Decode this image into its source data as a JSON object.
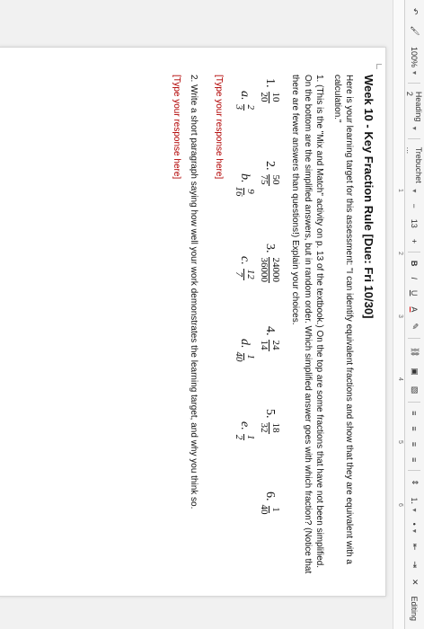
{
  "toolbar": {
    "zoom": "100%",
    "style": "Heading 2",
    "font": "Trebuchet ...",
    "size": "13",
    "plus": "+",
    "bold": "B",
    "italic": "I",
    "underline": "U",
    "text_color": "A",
    "edit": "Editing"
  },
  "ruler": {
    "ticks": [
      "1",
      "2",
      "3",
      "4",
      "5",
      "6"
    ]
  },
  "doc": {
    "title": "Week 10 - Key Fraction Rule [Due: Fri 10/30]",
    "intro": "Here is your learning target for this assessment: \"I can identify equivalent fractions and show that they are equivalent with a calculation.\"",
    "q1_text": "1. (This is the \"Mix and Match\" activity on p. 13 of the textbook.) On the top are some fractions that have not been simplified. On the bottom are the simplified answers, but in random order. Which simplified answer goes with which fraction? (Notice that there are fewer answers than questions!) Explain your choices.",
    "top": [
      {
        "label": "1.",
        "n": "10",
        "d": "20"
      },
      {
        "label": "2.",
        "n": "50",
        "d": "75"
      },
      {
        "label": "3.",
        "n": "24000",
        "d": "36000"
      },
      {
        "label": "4.",
        "n": "24",
        "d": "14"
      },
      {
        "label": "5.",
        "n": "18",
        "d": "32"
      },
      {
        "label": "6.",
        "n": "1",
        "d": "40"
      }
    ],
    "bottom": [
      {
        "label": "a.",
        "n": "2",
        "d": "3"
      },
      {
        "label": "b.",
        "n": "9",
        "d": "16"
      },
      {
        "label": "c.",
        "n": "12",
        "d": "7"
      },
      {
        "label": "d.",
        "n": "1",
        "d": "40"
      },
      {
        "label": "e.",
        "n": "1",
        "d": "2"
      }
    ],
    "response1": "[Type your response here]",
    "q2_text": "2. Write a short paragraph saying how well your work demonstrates the learning target, and why you think so.",
    "response2": "[Type your response here]"
  }
}
